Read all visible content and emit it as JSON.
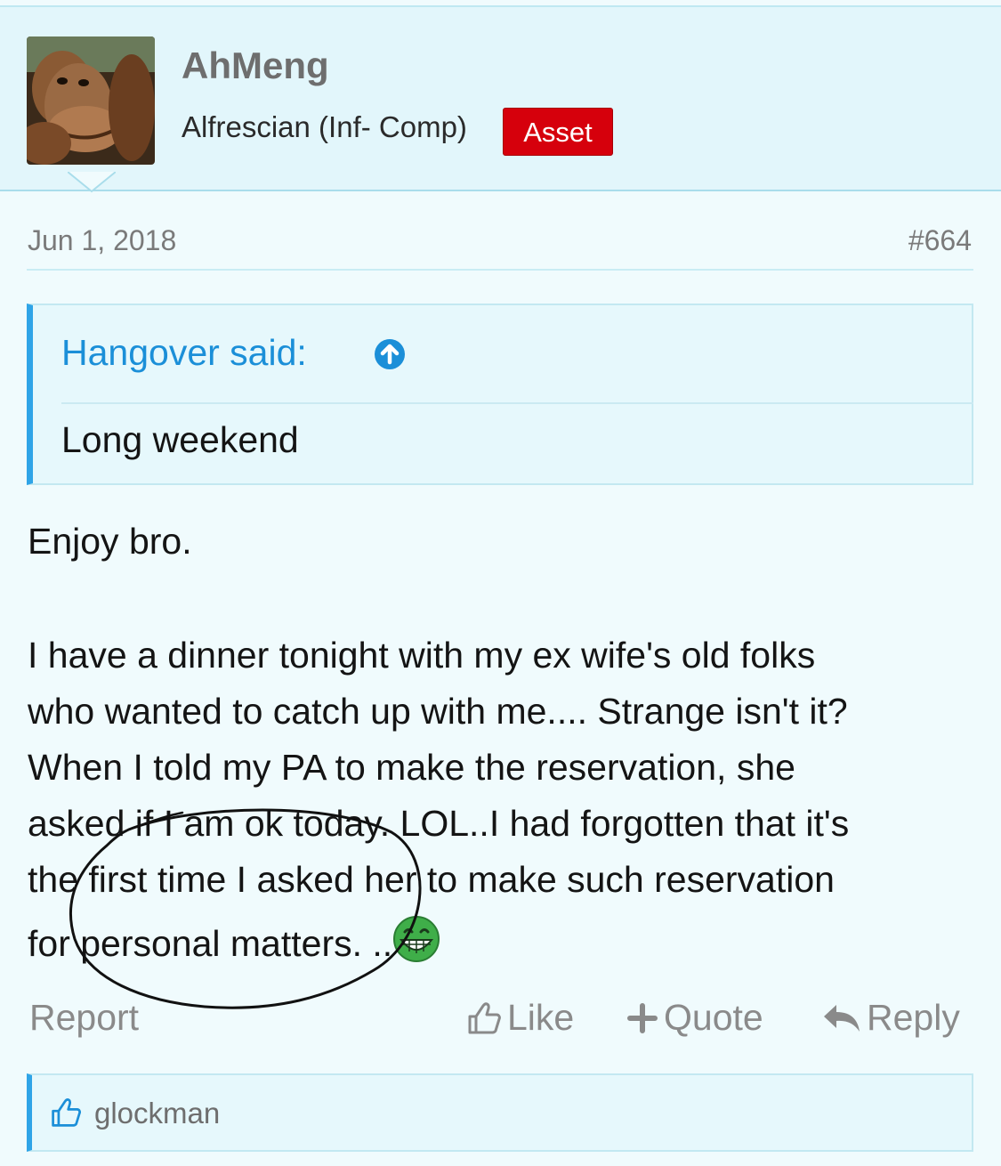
{
  "post": {
    "author": {
      "name": "AhMeng",
      "title": "Alfrescian (Inf- Comp)",
      "badge": "Asset",
      "avatar_icon": "orangutan-avatar"
    },
    "date": "Jun 1, 2018",
    "number": "#664",
    "quote": {
      "author": "Hangover said:",
      "text": "Long weekend"
    },
    "body": {
      "line1": "Enjoy bro.",
      "line2": "I have a dinner tonight with my ex wife's old folks",
      "line3": "who wanted to catch up with me.... Strange isn't it?",
      "line4": "When I told my PA to make the reservation, she",
      "line5": "asked if I am ok today. LOL..I had forgotten that it's",
      "line6": "the first time I asked her to make such reservation",
      "line7": "for personal matters. ..",
      "emoji": "grinning-emoji"
    },
    "actions": {
      "report": "Report",
      "like": "Like",
      "quote": "Quote",
      "reply": "Reply"
    },
    "likes": {
      "user": "glockman"
    }
  },
  "colors": {
    "background": "#f0fbfd",
    "header": "#e2f6fb",
    "accent": "#2fa4e7",
    "link": "#1b8fd8",
    "badge": "#d6000c",
    "muted": "#8a8a8a"
  }
}
